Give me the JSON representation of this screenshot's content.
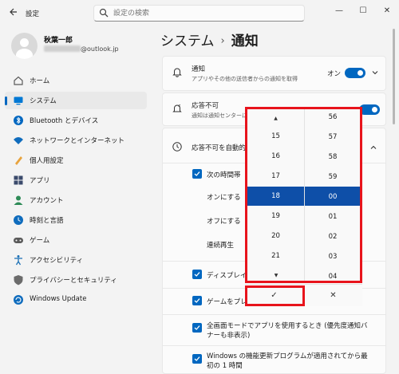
{
  "window": {
    "title": "設定",
    "minimize_glyph": "—",
    "maximize_glyph": "☐",
    "close_glyph": "✕"
  },
  "search": {
    "placeholder": "設定の検索"
  },
  "user": {
    "name": "秋葉一郎",
    "email_suffix": "@outlook.jp"
  },
  "sidebar": {
    "items": [
      {
        "label": "ホーム",
        "icon": "home-icon",
        "color": "#5a5a5a"
      },
      {
        "label": "システム",
        "icon": "system-icon",
        "color": "#0078d4"
      },
      {
        "label": "Bluetooth とデバイス",
        "icon": "bluetooth-icon",
        "color": "#0067c0"
      },
      {
        "label": "ネットワークとインターネット",
        "icon": "network-icon",
        "color": "#0f6cbd"
      },
      {
        "label": "個人用設定",
        "icon": "personalization-icon",
        "color": "#e8a33d"
      },
      {
        "label": "アプリ",
        "icon": "apps-icon",
        "color": "#3a4a6b"
      },
      {
        "label": "アカウント",
        "icon": "accounts-icon",
        "color": "#2e8b57"
      },
      {
        "label": "時刻と言語",
        "icon": "time-language-icon",
        "color": "#0f6cbd"
      },
      {
        "label": "ゲーム",
        "icon": "gaming-icon",
        "color": "#5a5a5a"
      },
      {
        "label": "アクセシビリティ",
        "icon": "accessibility-icon",
        "color": "#1a6fb5"
      },
      {
        "label": "プライバシーとセキュリティ",
        "icon": "privacy-icon",
        "color": "#6b6b6b"
      },
      {
        "label": "Windows Update",
        "icon": "windows-update-icon",
        "color": "#0f6cbd"
      }
    ],
    "selected_index": 1
  },
  "breadcrumb": {
    "parent": "システム",
    "separator": "›",
    "current": "通知"
  },
  "notifications": {
    "title": "通知",
    "desc": "アプリやその他の送信者からの通知を取得",
    "state": "オン"
  },
  "dnd": {
    "title": "応答不可",
    "desc": "通知は通知センターに",
    "state": "オン"
  },
  "auto_dnd": {
    "title": "応答不可を自動的",
    "time_range_label": "次の時間帯",
    "on_label": "オンにする",
    "off_label": "オフにする",
    "repeat_label": "連続再生",
    "display_dup": "ディスプレイを複",
    "gaming": "ゲームをプレイ",
    "fullscreen": "全画面モードでアプリを使用するとき (優先度通知バナーも非表示)",
    "windows_update": "Windows の機能更新プログラムが適用されてから最初の 1 時間"
  },
  "picker": {
    "up_glyph": "▲",
    "down_glyph": "▼",
    "hours": [
      "15",
      "16",
      "17",
      "18",
      "19",
      "20",
      "21"
    ],
    "minutes": [
      "56",
      "57",
      "58",
      "59",
      "00",
      "01",
      "02",
      "03",
      "04"
    ],
    "selected_hour": "18",
    "selected_minute": "00",
    "accept_glyph": "✓",
    "dismiss_glyph": "✕"
  },
  "colors": {
    "accent": "#0067c0",
    "highlight_box": "#e8141c",
    "picker_selection": "#0e4fa8"
  }
}
